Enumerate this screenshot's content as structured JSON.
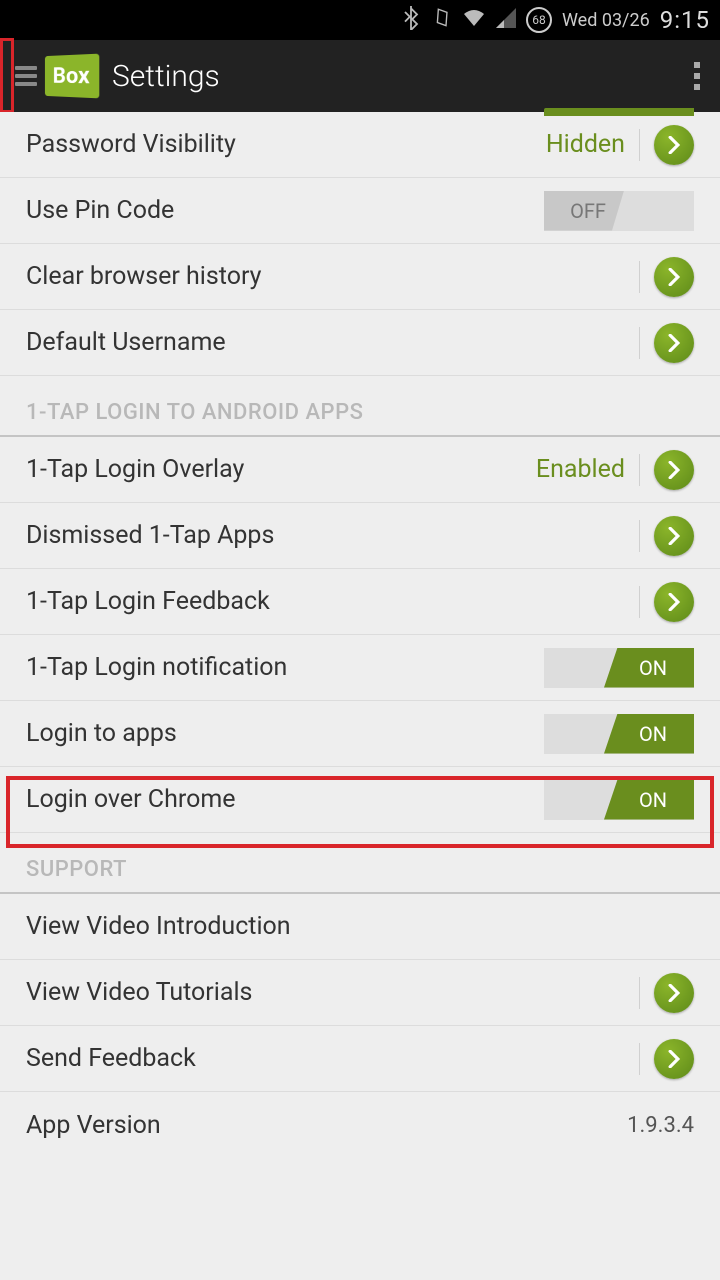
{
  "status": {
    "battery": "68",
    "date": "Wed 03/26",
    "time": "9:15"
  },
  "appbar": {
    "logo_text": "Box",
    "title": "Settings"
  },
  "rows": {
    "password_visibility": {
      "label": "Password Visibility",
      "value": "Hidden"
    },
    "use_pin": {
      "label": "Use Pin Code",
      "toggle": "OFF"
    },
    "clear_history": {
      "label": "Clear browser history"
    },
    "default_username": {
      "label": "Default Username"
    }
  },
  "section1": "1-TAP LOGIN TO ANDROID APPS",
  "tap": {
    "overlay": {
      "label": "1-Tap Login Overlay",
      "value": "Enabled"
    },
    "dismissed": {
      "label": "Dismissed 1-Tap Apps"
    },
    "feedback": {
      "label": "1-Tap Login Feedback"
    },
    "notification": {
      "label": "1-Tap Login notification",
      "toggle": "ON"
    },
    "login_apps": {
      "label": "Login to apps",
      "toggle": "ON"
    },
    "login_chrome": {
      "label": "Login over Chrome",
      "toggle": "ON"
    }
  },
  "section2": "SUPPORT",
  "support": {
    "video_intro": {
      "label": "View Video Introduction"
    },
    "video_tut": {
      "label": "View Video Tutorials"
    },
    "send_feedback": {
      "label": "Send Feedback"
    },
    "app_version": {
      "label": "App Version",
      "value": "1.9.3.4"
    }
  }
}
